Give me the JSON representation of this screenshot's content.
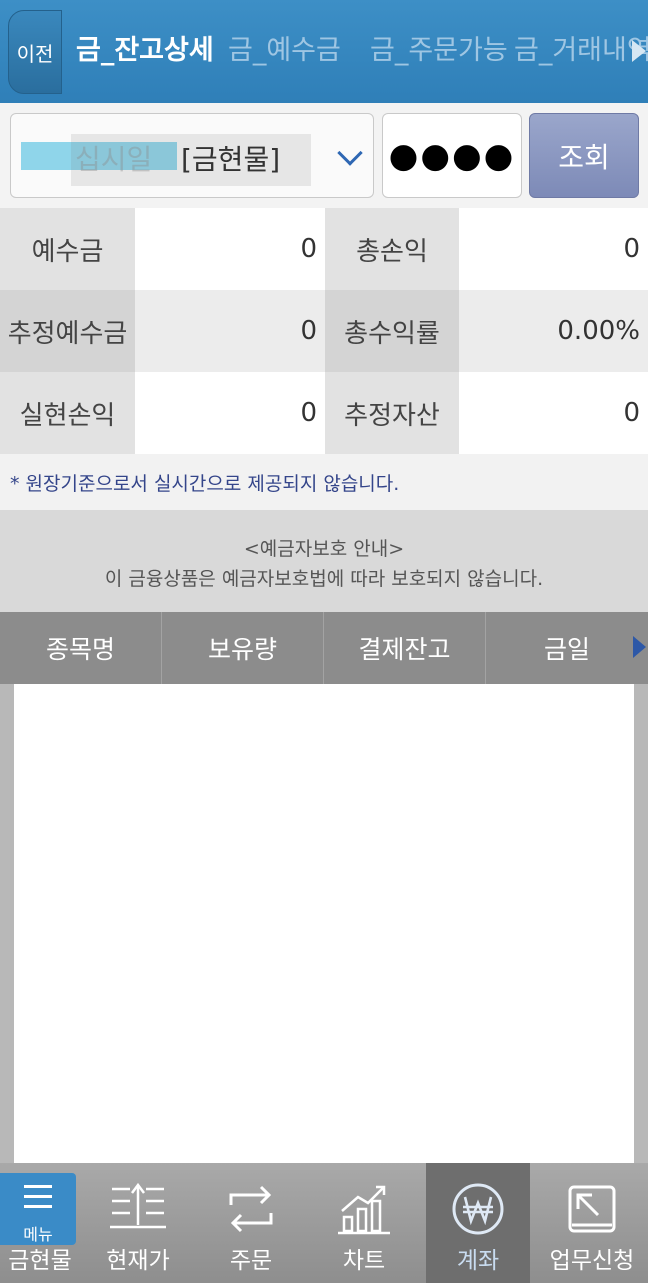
{
  "tabs": {
    "prev_label": "이전",
    "items": [
      {
        "label": "금_잔고상세",
        "active": true
      },
      {
        "label": "금_예수금",
        "active": false
      },
      {
        "label": "금_주문가능",
        "active": false
      },
      {
        "label": "금_거래내역",
        "active": false
      }
    ]
  },
  "account": {
    "ghost_text": "십시일",
    "type_label": "[금현물]",
    "password_mask": "●●●●",
    "search_label": "조회"
  },
  "summary": {
    "deposit_label": "예수금",
    "deposit_value": "0",
    "total_pl_label": "총손익",
    "total_pl_value": "0",
    "est_deposit_label": "추정예수금",
    "est_deposit_value": "0",
    "total_return_label": "총수익률",
    "total_return_value": "0.00%",
    "realized_pl_label": "실현손익",
    "realized_pl_value": "0",
    "est_asset_label": "추정자산",
    "est_asset_value": "0"
  },
  "notes": {
    "basis_note": "* 원장기준으로서 실시간으로 제공되지 않습니다.",
    "protection_title": "<예금자보호 안내>",
    "protection_text": "이 금융상품은 예금자보호법에 따라 보호되지 않습니다."
  },
  "table": {
    "columns": [
      "종목명",
      "보유량",
      "결제잔고",
      "금일"
    ]
  },
  "bottom_nav": {
    "menu_label": "메뉴",
    "items": [
      {
        "label": "금현물",
        "icon": "menu-icon"
      },
      {
        "label": "현재가",
        "icon": "price-icon"
      },
      {
        "label": "주문",
        "icon": "order-icon"
      },
      {
        "label": "차트",
        "icon": "chart-icon"
      },
      {
        "label": "계좌",
        "icon": "won-icon",
        "active": true
      },
      {
        "label": "업무신청",
        "icon": "request-icon"
      }
    ]
  },
  "colors": {
    "header_blue": "#2f7fb8",
    "search_button": "#8591bd",
    "note_text": "#34458a",
    "table_header": "#8c8c8c"
  }
}
